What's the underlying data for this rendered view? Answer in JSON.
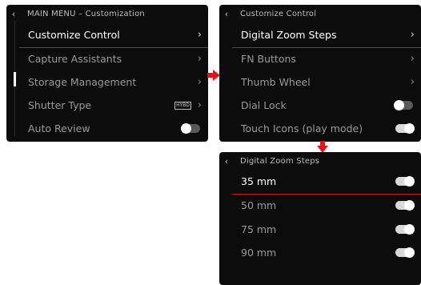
{
  "colors": {
    "accent": "#c3161c",
    "panel": "#0c0c0c",
    "text_active": "#ffffff",
    "text_inactive": "#9a9a9a"
  },
  "main_menu": {
    "title": "MAIN MENU – Customization",
    "items": [
      {
        "label": "Customize Control",
        "control": "chevron",
        "active": true
      },
      {
        "label": "Capture Assistants",
        "control": "chevron",
        "active": false
      },
      {
        "label": "Storage Management",
        "control": "chevron",
        "active": false
      },
      {
        "label": "Shutter Type",
        "control": "chevron",
        "badge": "HYBD",
        "active": false
      },
      {
        "label": "Auto Review",
        "control": "toggle",
        "toggle_on": false,
        "active": false
      }
    ]
  },
  "customize_control": {
    "title": "Customize Control",
    "items": [
      {
        "label": "Digital Zoom Steps",
        "control": "chevron",
        "active": true
      },
      {
        "label": "FN Buttons",
        "control": "chevron",
        "active": false
      },
      {
        "label": "Thumb Wheel",
        "control": "chevron",
        "active": false
      },
      {
        "label": "Dial Lock",
        "control": "toggle",
        "toggle_on": false,
        "active": false
      },
      {
        "label": "Touch Icons (play mode)",
        "control": "toggle",
        "toggle_on": true,
        "active": false
      }
    ]
  },
  "digital_zoom_steps": {
    "title": "Digital Zoom Steps",
    "items": [
      {
        "label": "35 mm",
        "toggle_on": true,
        "active": true
      },
      {
        "label": "50 mm",
        "toggle_on": true,
        "active": false
      },
      {
        "label": "75 mm",
        "toggle_on": true,
        "active": false
      },
      {
        "label": "90 mm",
        "toggle_on": true,
        "active": false
      }
    ]
  },
  "icons": {
    "back": "chevron-left-icon",
    "next": "chevron-right-icon",
    "flow": "arrow-icon"
  }
}
